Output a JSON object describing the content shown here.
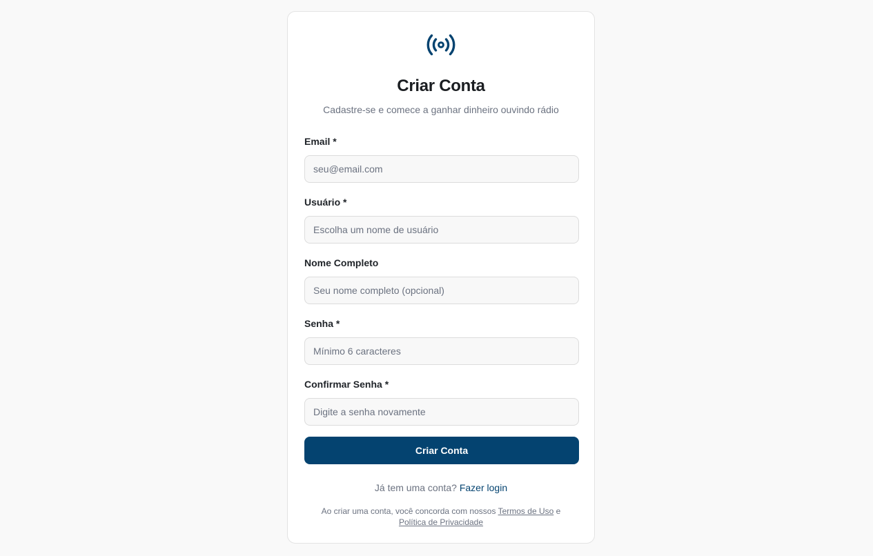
{
  "brand": {
    "icon": "radio-broadcast-icon",
    "accent_color": "#044370"
  },
  "header": {
    "title": "Criar Conta",
    "subtitle": "Cadastre-se e comece a ganhar dinheiro ouvindo rádio"
  },
  "form": {
    "fields": [
      {
        "label": "Email *",
        "placeholder": "seu@email.com"
      },
      {
        "label": "Usuário *",
        "placeholder": "Escolha um nome de usuário"
      },
      {
        "label": "Nome Completo",
        "placeholder": "Seu nome completo (opcional)"
      },
      {
        "label": "Senha *",
        "placeholder": "Mínimo 6 caracteres"
      },
      {
        "label": "Confirmar Senha *",
        "placeholder": "Digite a senha novamente"
      }
    ],
    "submit_label": "Criar Conta"
  },
  "footer": {
    "login_prompt": "Já tem uma conta?",
    "login_link": "Fazer login",
    "terms_prefix": "Ao criar uma conta, você concorda com nossos",
    "terms_link": "Termos de Uso",
    "terms_joiner": "e",
    "privacy_link": "Política de Privacidade"
  }
}
